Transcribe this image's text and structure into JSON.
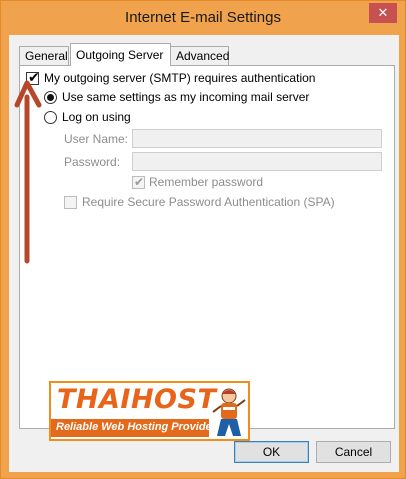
{
  "window": {
    "title": "Internet E-mail Settings",
    "close_glyph": "✕"
  },
  "tabs": [
    {
      "label": "General",
      "active": false
    },
    {
      "label": "Outgoing Server",
      "active": true
    },
    {
      "label": "Advanced",
      "active": false
    }
  ],
  "outgoing": {
    "requires_auth_label": "My outgoing server (SMTP) requires authentication",
    "requires_auth_checked": true,
    "same_settings_label": "Use same settings as my incoming mail server",
    "same_settings_selected": true,
    "log_on_label": "Log on using",
    "log_on_selected": false,
    "username_label": "User Name:",
    "username_value": "",
    "password_label": "Password:",
    "password_value": "",
    "remember_label": "Remember password",
    "remember_checked": true,
    "spa_label": "Require Secure Password Authentication (SPA)",
    "spa_checked": false
  },
  "annotation": {
    "arrow_color": "#b7472a"
  },
  "logo": {
    "wordmark": "THAIHOST",
    "subtitle": "Reliable Web Hosting Provider",
    "brand_color": "#e8641a"
  },
  "buttons": {
    "ok": "OK",
    "cancel": "Cancel"
  },
  "colors": {
    "frame": "#f0a34c",
    "close": "#c75050"
  }
}
